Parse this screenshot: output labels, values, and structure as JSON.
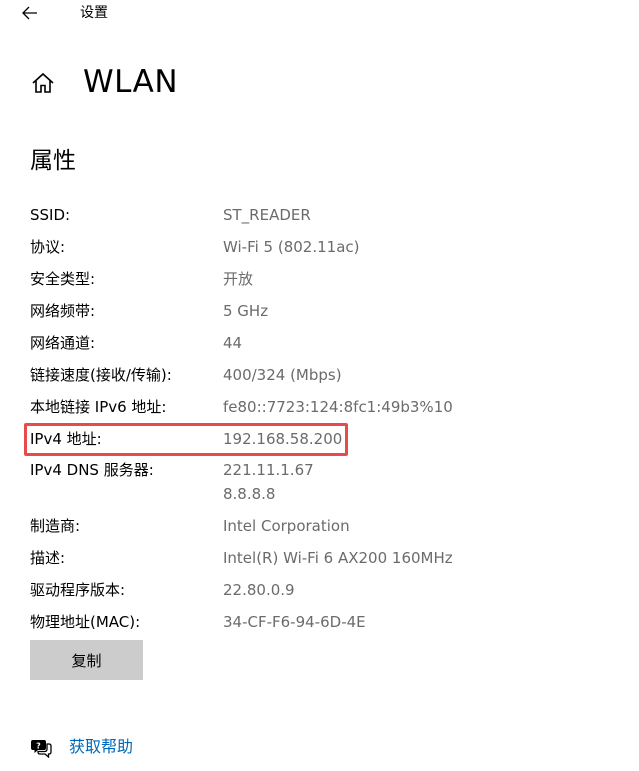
{
  "window": {
    "title": "设置"
  },
  "header": {
    "title": "WLAN"
  },
  "section": {
    "title": "属性"
  },
  "properties": [
    {
      "label": "SSID:",
      "values": [
        "ST_READER"
      ]
    },
    {
      "label": "协议:",
      "values": [
        "Wi-Fi 5 (802.11ac)"
      ]
    },
    {
      "label": "安全类型:",
      "values": [
        "开放"
      ]
    },
    {
      "label": "网络频带:",
      "values": [
        "5 GHz"
      ]
    },
    {
      "label": "网络通道:",
      "values": [
        "44"
      ]
    },
    {
      "label": "链接速度(接收/传输):",
      "values": [
        "400/324 (Mbps)"
      ]
    },
    {
      "label": "本地链接 IPv6 地址:",
      "values": [
        "fe80::7723:124:8fc1:49b3%10"
      ]
    },
    {
      "label": "IPv4 地址:",
      "values": [
        "192.168.58.200"
      ]
    },
    {
      "label": "IPv4 DNS 服务器:",
      "values": [
        "221.11.1.67",
        "8.8.8.8"
      ]
    },
    {
      "label": "制造商:",
      "values": [
        "Intel Corporation"
      ]
    },
    {
      "label": "描述:",
      "values": [
        "Intel(R) Wi-Fi 6 AX200 160MHz"
      ]
    },
    {
      "label": "驱动程序版本:",
      "values": [
        "22.80.0.9"
      ]
    },
    {
      "label": "物理地址(MAC):",
      "values": [
        "34-CF-F6-94-6D-4E"
      ]
    }
  ],
  "copy_button": {
    "label": "复制"
  },
  "help": {
    "label": "获取帮助"
  },
  "colors": {
    "value_text": "#6b6b6b",
    "highlight_border": "#e84b4b",
    "button_bg": "#cccccc",
    "link": "#0067b8"
  },
  "icons": {
    "back": "arrow-left-icon",
    "home": "home-icon",
    "help": "chat-help-icon"
  }
}
